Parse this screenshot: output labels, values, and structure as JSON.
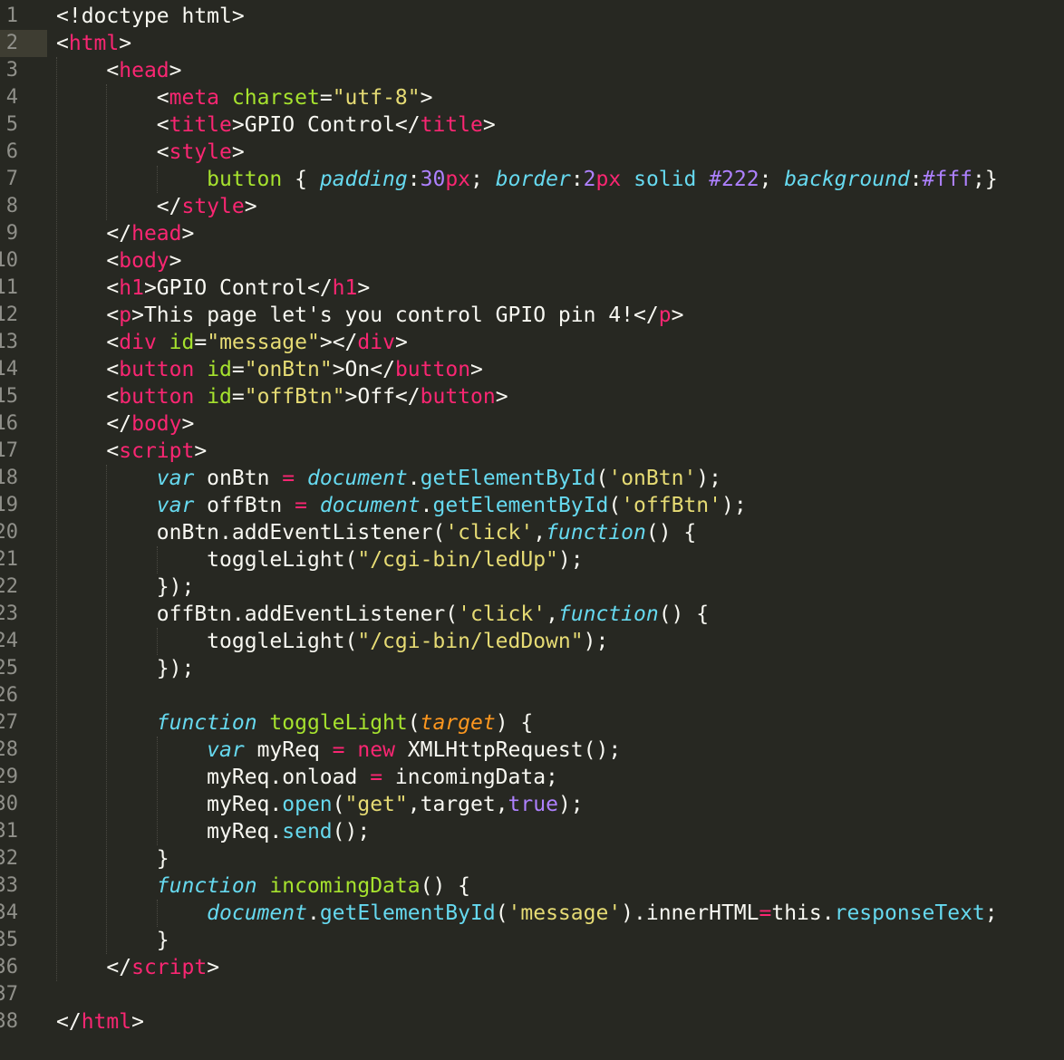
{
  "editor": {
    "theme_colors": {
      "background": "#272822",
      "current_line": "#3e3d32",
      "gutter_text": "#90908a",
      "tag": "#f92672",
      "attribute": "#a6e22e",
      "string": "#e6db74",
      "number": "#ae81ff",
      "italic_blue": "#66d9ef",
      "parameter": "#fd971f",
      "plain": "#f8f8f2"
    },
    "current_line_index": 1,
    "lines": [
      {
        "n": "1",
        "indent": 0,
        "tokens": [
          [
            "p",
            "<!doctype html>"
          ]
        ]
      },
      {
        "n": "2",
        "indent": 0,
        "tokens": [
          [
            "p",
            "<"
          ],
          [
            "tag",
            "html"
          ],
          [
            "p",
            ">"
          ]
        ]
      },
      {
        "n": "3",
        "indent": 1,
        "tokens": [
          [
            "p",
            "<"
          ],
          [
            "tag",
            "head"
          ],
          [
            "p",
            ">"
          ]
        ]
      },
      {
        "n": "4",
        "indent": 2,
        "tokens": [
          [
            "p",
            "<"
          ],
          [
            "tag",
            "meta"
          ],
          [
            "p",
            " "
          ],
          [
            "attr",
            "charset"
          ],
          [
            "p",
            "="
          ],
          [
            "str",
            "\"utf-8\""
          ],
          [
            "p",
            ">"
          ]
        ]
      },
      {
        "n": "5",
        "indent": 2,
        "tokens": [
          [
            "p",
            "<"
          ],
          [
            "tag",
            "title"
          ],
          [
            "p",
            ">GPIO Control</"
          ],
          [
            "tag",
            "title"
          ],
          [
            "p",
            ">"
          ]
        ]
      },
      {
        "n": "6",
        "indent": 2,
        "tokens": [
          [
            "p",
            "<"
          ],
          [
            "tag",
            "style"
          ],
          [
            "p",
            ">"
          ]
        ]
      },
      {
        "n": "7",
        "indent": 3,
        "tokens": [
          [
            "func",
            "button"
          ],
          [
            "p",
            " { "
          ],
          [
            "prop",
            "padding"
          ],
          [
            "p",
            ":"
          ],
          [
            "num",
            "30"
          ],
          [
            "tag",
            "px"
          ],
          [
            "p",
            "; "
          ],
          [
            "prop",
            "border"
          ],
          [
            "p",
            ":"
          ],
          [
            "num",
            "2"
          ],
          [
            "tag",
            "px"
          ],
          [
            "p",
            " "
          ],
          [
            "support",
            "solid"
          ],
          [
            "p",
            " "
          ],
          [
            "num",
            "#222"
          ],
          [
            "p",
            "; "
          ],
          [
            "prop",
            "background"
          ],
          [
            "p",
            ":"
          ],
          [
            "num",
            "#fff"
          ],
          [
            "p",
            ";}"
          ]
        ]
      },
      {
        "n": "8",
        "indent": 2,
        "tokens": [
          [
            "p",
            "</"
          ],
          [
            "tag",
            "style"
          ],
          [
            "p",
            ">"
          ]
        ]
      },
      {
        "n": "9",
        "indent": 1,
        "tokens": [
          [
            "p",
            "</"
          ],
          [
            "tag",
            "head"
          ],
          [
            "p",
            ">"
          ]
        ]
      },
      {
        "n": "10",
        "indent": 1,
        "tokens": [
          [
            "p",
            "<"
          ],
          [
            "tag",
            "body"
          ],
          [
            "p",
            ">"
          ]
        ]
      },
      {
        "n": "11",
        "indent": 1,
        "tokens": [
          [
            "p",
            "<"
          ],
          [
            "tag",
            "h1"
          ],
          [
            "p",
            ">GPIO Control</"
          ],
          [
            "tag",
            "h1"
          ],
          [
            "p",
            ">"
          ]
        ]
      },
      {
        "n": "12",
        "indent": 1,
        "tokens": [
          [
            "p",
            "<"
          ],
          [
            "tag",
            "p"
          ],
          [
            "p",
            ">This page let's you control GPIO pin 4!</"
          ],
          [
            "tag",
            "p"
          ],
          [
            "p",
            ">"
          ]
        ]
      },
      {
        "n": "13",
        "indent": 1,
        "tokens": [
          [
            "p",
            "<"
          ],
          [
            "tag",
            "div"
          ],
          [
            "p",
            " "
          ],
          [
            "attr",
            "id"
          ],
          [
            "p",
            "="
          ],
          [
            "str",
            "\"message\""
          ],
          [
            "p",
            "></"
          ],
          [
            "tag",
            "div"
          ],
          [
            "p",
            ">"
          ]
        ]
      },
      {
        "n": "14",
        "indent": 1,
        "tokens": [
          [
            "p",
            "<"
          ],
          [
            "tag",
            "button"
          ],
          [
            "p",
            " "
          ],
          [
            "attr",
            "id"
          ],
          [
            "p",
            "="
          ],
          [
            "str",
            "\"onBtn\""
          ],
          [
            "p",
            ">On</"
          ],
          [
            "tag",
            "button"
          ],
          [
            "p",
            ">"
          ]
        ]
      },
      {
        "n": "15",
        "indent": 1,
        "tokens": [
          [
            "p",
            "<"
          ],
          [
            "tag",
            "button"
          ],
          [
            "p",
            " "
          ],
          [
            "attr",
            "id"
          ],
          [
            "p",
            "="
          ],
          [
            "str",
            "\"offBtn\""
          ],
          [
            "p",
            ">Off</"
          ],
          [
            "tag",
            "button"
          ],
          [
            "p",
            ">"
          ]
        ]
      },
      {
        "n": "16",
        "indent": 1,
        "tokens": [
          [
            "p",
            "</"
          ],
          [
            "tag",
            "body"
          ],
          [
            "p",
            ">"
          ]
        ]
      },
      {
        "n": "17",
        "indent": 1,
        "tokens": [
          [
            "p",
            "<"
          ],
          [
            "tag",
            "script"
          ],
          [
            "p",
            ">"
          ]
        ]
      },
      {
        "n": "18",
        "indent": 2,
        "tokens": [
          [
            "storage",
            "var"
          ],
          [
            "p",
            " onBtn "
          ],
          [
            "op",
            "="
          ],
          [
            "p",
            " "
          ],
          [
            "storage",
            "document"
          ],
          [
            "p",
            "."
          ],
          [
            "support",
            "getElementById"
          ],
          [
            "p",
            "("
          ],
          [
            "str",
            "'onBtn'"
          ],
          [
            "p",
            ");"
          ]
        ]
      },
      {
        "n": "19",
        "indent": 2,
        "tokens": [
          [
            "storage",
            "var"
          ],
          [
            "p",
            " offBtn "
          ],
          [
            "op",
            "="
          ],
          [
            "p",
            " "
          ],
          [
            "storage",
            "document"
          ],
          [
            "p",
            "."
          ],
          [
            "support",
            "getElementById"
          ],
          [
            "p",
            "("
          ],
          [
            "str",
            "'offBtn'"
          ],
          [
            "p",
            ");"
          ]
        ]
      },
      {
        "n": "20",
        "indent": 2,
        "tokens": [
          [
            "p",
            "onBtn.addEventListener("
          ],
          [
            "str",
            "'click'"
          ],
          [
            "p",
            ","
          ],
          [
            "storage",
            "function"
          ],
          [
            "p",
            "() {"
          ]
        ]
      },
      {
        "n": "21",
        "indent": 3,
        "tokens": [
          [
            "p",
            "toggleLight("
          ],
          [
            "str",
            "\"/cgi-bin/ledUp\""
          ],
          [
            "p",
            ");"
          ]
        ]
      },
      {
        "n": "22",
        "indent": 2,
        "tokens": [
          [
            "p",
            "});"
          ]
        ]
      },
      {
        "n": "23",
        "indent": 2,
        "tokens": [
          [
            "p",
            "offBtn.addEventListener("
          ],
          [
            "str",
            "'click'"
          ],
          [
            "p",
            ","
          ],
          [
            "storage",
            "function"
          ],
          [
            "p",
            "() {"
          ]
        ]
      },
      {
        "n": "24",
        "indent": 3,
        "tokens": [
          [
            "p",
            "toggleLight("
          ],
          [
            "str",
            "\"/cgi-bin/ledDown\""
          ],
          [
            "p",
            ");"
          ]
        ]
      },
      {
        "n": "25",
        "indent": 2,
        "tokens": [
          [
            "p",
            "});"
          ]
        ]
      },
      {
        "n": "26",
        "indent": 0,
        "tokens": []
      },
      {
        "n": "27",
        "indent": 2,
        "tokens": [
          [
            "storage",
            "function"
          ],
          [
            "p",
            " "
          ],
          [
            "func",
            "toggleLight"
          ],
          [
            "p",
            "("
          ],
          [
            "param",
            "target"
          ],
          [
            "p",
            ") {"
          ]
        ]
      },
      {
        "n": "28",
        "indent": 3,
        "tokens": [
          [
            "storage",
            "var"
          ],
          [
            "p",
            " myReq "
          ],
          [
            "op",
            "="
          ],
          [
            "p",
            " "
          ],
          [
            "kw",
            "new"
          ],
          [
            "p",
            " XMLHttpRequest();"
          ]
        ]
      },
      {
        "n": "29",
        "indent": 3,
        "tokens": [
          [
            "p",
            "myReq.onload "
          ],
          [
            "op",
            "="
          ],
          [
            "p",
            " incomingData;"
          ]
        ]
      },
      {
        "n": "30",
        "indent": 3,
        "tokens": [
          [
            "p",
            "myReq."
          ],
          [
            "support",
            "open"
          ],
          [
            "p",
            "("
          ],
          [
            "str",
            "\"get\""
          ],
          [
            "p",
            ",target,"
          ],
          [
            "num",
            "true"
          ],
          [
            "p",
            ");"
          ]
        ]
      },
      {
        "n": "31",
        "indent": 3,
        "tokens": [
          [
            "p",
            "myReq."
          ],
          [
            "support",
            "send"
          ],
          [
            "p",
            "();"
          ]
        ]
      },
      {
        "n": "32",
        "indent": 2,
        "tokens": [
          [
            "p",
            "}"
          ]
        ]
      },
      {
        "n": "33",
        "indent": 2,
        "tokens": [
          [
            "storage",
            "function"
          ],
          [
            "p",
            " "
          ],
          [
            "func",
            "incomingData"
          ],
          [
            "p",
            "() {"
          ]
        ]
      },
      {
        "n": "34",
        "indent": 3,
        "tokens": [
          [
            "storage",
            "document"
          ],
          [
            "p",
            "."
          ],
          [
            "support",
            "getElementById"
          ],
          [
            "p",
            "("
          ],
          [
            "str",
            "'message'"
          ],
          [
            "p",
            ").innerHTML"
          ],
          [
            "op",
            "="
          ],
          [
            "p",
            "this."
          ],
          [
            "support",
            "responseText"
          ],
          [
            "p",
            ";"
          ]
        ]
      },
      {
        "n": "35",
        "indent": 2,
        "tokens": [
          [
            "p",
            "}"
          ]
        ]
      },
      {
        "n": "36",
        "indent": 1,
        "tokens": [
          [
            "p",
            "</"
          ],
          [
            "tag",
            "script"
          ],
          [
            "p",
            ">"
          ]
        ]
      },
      {
        "n": "37",
        "indent": 0,
        "tokens": []
      },
      {
        "n": "38",
        "indent": 0,
        "tokens": [
          [
            "p",
            "</"
          ],
          [
            "tag",
            "html"
          ],
          [
            "p",
            ">"
          ]
        ]
      }
    ]
  }
}
